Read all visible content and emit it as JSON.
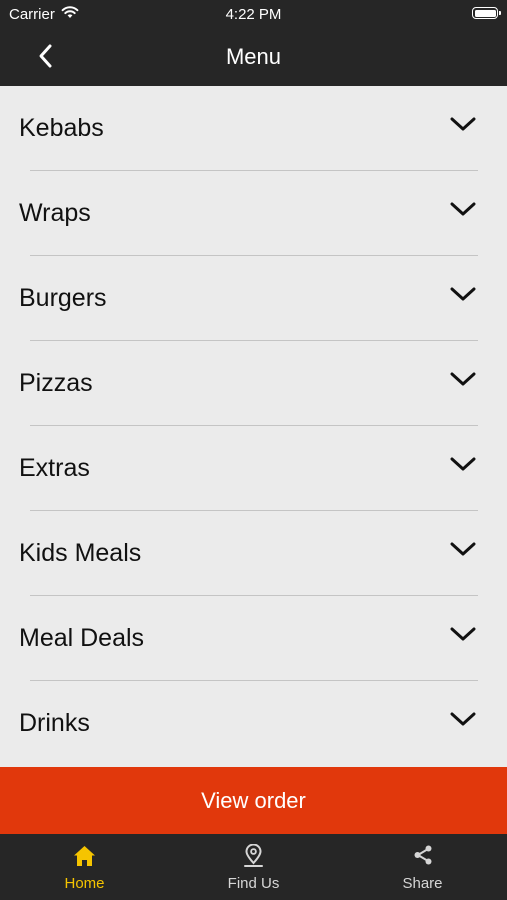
{
  "status_bar": {
    "carrier": "Carrier",
    "time": "4:22 PM"
  },
  "navbar": {
    "title": "Menu",
    "back_icon": "chevron-left-icon"
  },
  "menu": {
    "items": [
      {
        "label": "Kebabs"
      },
      {
        "label": "Wraps"
      },
      {
        "label": "Burgers"
      },
      {
        "label": "Pizzas"
      },
      {
        "label": "Extras"
      },
      {
        "label": "Kids Meals"
      },
      {
        "label": "Meal Deals"
      },
      {
        "label": "Drinks"
      }
    ],
    "expand_icon": "chevron-down-icon"
  },
  "view_order": {
    "label": "View order",
    "color": "#e1380c"
  },
  "tab_bar": {
    "active_color": "#f5c400",
    "tabs": [
      {
        "label": "Home",
        "icon": "home-icon",
        "active": true
      },
      {
        "label": "Find Us",
        "icon": "location-pin-icon",
        "active": false
      },
      {
        "label": "Share",
        "icon": "share-icon",
        "active": false
      }
    ]
  }
}
